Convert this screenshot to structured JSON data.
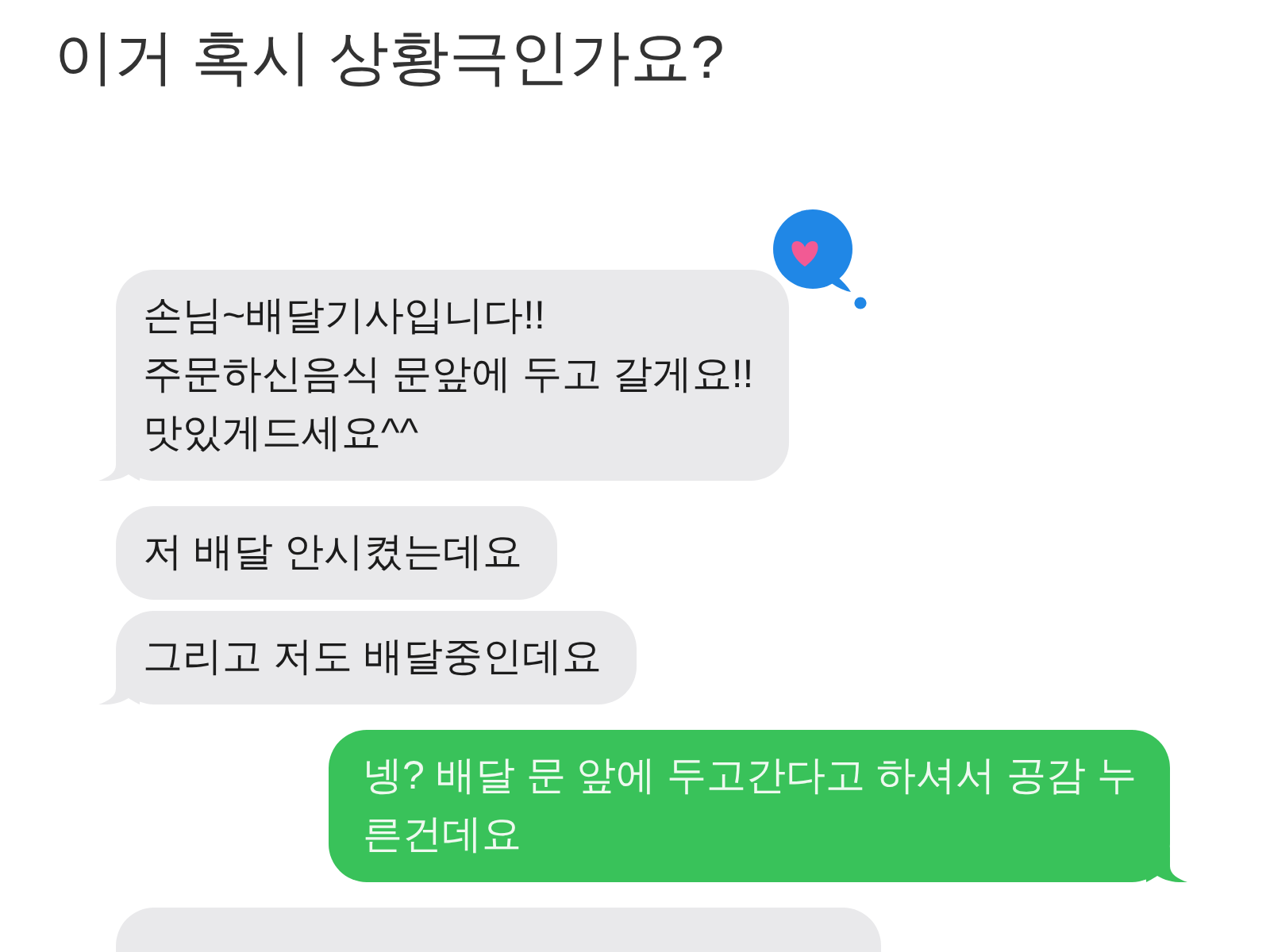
{
  "title": "이거 혹시 상황극인가요?",
  "messages": [
    {
      "kind": "received",
      "lines": [
        "손님~배달기사입니다!!",
        "주문하신음식 문앞에 두고 갈게요!!",
        "맛있게드세요^^"
      ],
      "tail": true,
      "hearted": true
    },
    {
      "kind": "received",
      "lines": [
        "저 배달 안시켰는데요"
      ],
      "tail": false,
      "hearted": false
    },
    {
      "kind": "received",
      "lines": [
        "그리고 저도 배달중인데요"
      ],
      "tail": true,
      "hearted": false
    },
    {
      "kind": "sent",
      "lines": [
        "넹? 배달 문 앞에 두고간다고 하셔서 공감 누",
        "른건데요"
      ],
      "tail": true,
      "hearted": false
    },
    {
      "kind": "received",
      "tail": false,
      "hearted": false
    }
  ]
}
